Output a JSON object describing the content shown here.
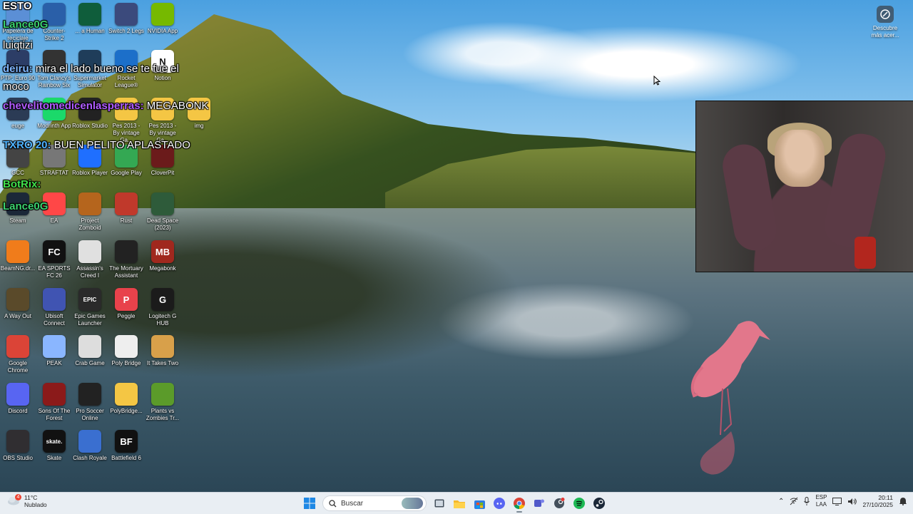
{
  "desktop_icons": [
    {
      "id": "papelera",
      "label": "Papelera de reciclaje",
      "icon": "recycle-bin-icon",
      "color": "#5b8fd6"
    },
    {
      "id": "counter",
      "label": "Counter-Strike 2",
      "icon": "cs2-icon",
      "color": "#2a5fa8"
    },
    {
      "id": "human",
      "label": "... a Human",
      "icon": "game-icon",
      "color": "#0f5d3b"
    },
    {
      "id": "switchlegs",
      "label": "Switch 2 Legs",
      "icon": "game-icon",
      "color": "#3b4a7c"
    },
    {
      "id": "nvidia",
      "label": "NVIDIA App",
      "icon": "nvidia-icon",
      "color": "#76b900"
    },
    {
      "id": "ptp",
      "label": "PTP: Euro 90",
      "icon": "game-icon",
      "color": "#2c3d66"
    },
    {
      "id": "rainbow",
      "label": "Tom Clancy's Rainbow Six",
      "icon": "r6-icon",
      "color": "#333"
    },
    {
      "id": "supermarket",
      "label": "Supermarket Simulator",
      "icon": "game-icon",
      "color": "#1f3d5a"
    },
    {
      "id": "rocket",
      "label": "Rocket League®",
      "icon": "rocket-league-icon",
      "color": "#1c6fc9"
    },
    {
      "id": "notion",
      "label": "Notion",
      "icon": "notion-icon",
      "color": "#ffffff",
      "text": "N"
    },
    {
      "id": "euge",
      "label": "euge",
      "icon": "image-icon",
      "color": "#2b3b55"
    },
    {
      "id": "modrinth",
      "label": "Modrinth App",
      "icon": "modrinth-icon",
      "color": "#1bd96a"
    },
    {
      "id": "roblox",
      "label": "Roblox Studio",
      "icon": "roblox-studio-icon",
      "color": "#222"
    },
    {
      "id": "pes1",
      "label": "Pes 2013 - By vintage Ga...",
      "icon": "folder-icon",
      "color": "#f4c644"
    },
    {
      "id": "pes2",
      "label": "Pes 2013 - By vintage Ga...",
      "icon": "folder-icon",
      "color": "#f4c644"
    },
    {
      "id": "img",
      "label": "img",
      "icon": "folder-icon",
      "color": "#f4c644"
    },
    {
      "id": "gcc",
      "label": "GCC",
      "icon": "game-icon",
      "color": "#444"
    },
    {
      "id": "strafat",
      "label": "STRAFTAT",
      "icon": "game-icon",
      "color": "#777"
    },
    {
      "id": "robloxplayer",
      "label": "Roblox Player",
      "icon": "roblox-icon",
      "color": "#1f6fff"
    },
    {
      "id": "googleplay",
      "label": "Google Play",
      "icon": "google-play-icon",
      "color": "#34a853"
    },
    {
      "id": "cloverpit",
      "label": "CloverPit",
      "icon": "game-icon",
      "color": "#6b1b1b"
    },
    {
      "id": "steam",
      "label": "Steam",
      "icon": "steam-icon",
      "color": "#1b2838"
    },
    {
      "id": "ea",
      "label": "EA",
      "icon": "ea-icon",
      "color": "#ff4747"
    },
    {
      "id": "zomboid",
      "label": "Project Zomboid",
      "icon": "zomboid-icon",
      "color": "#b5651d"
    },
    {
      "id": "rust",
      "label": "Rust",
      "icon": "rust-icon",
      "color": "#c0392b"
    },
    {
      "id": "deadspace",
      "label": "Dead Space (2023)",
      "icon": "dead-space-icon",
      "color": "#2e5b3a"
    },
    {
      "id": "beamng",
      "label": "BeamNG.dr...",
      "icon": "beamng-icon",
      "color": "#f07c1b"
    },
    {
      "id": "fc26",
      "label": "EA SPORTS FC 26",
      "icon": "fc26-icon",
      "color": "#111",
      "text": "FC"
    },
    {
      "id": "assassin",
      "label": "Assassin's Creed I",
      "icon": "assassins-creed-icon",
      "color": "#e0e0e0"
    },
    {
      "id": "mortuary",
      "label": "The Mortuary Assistant",
      "icon": "game-icon",
      "color": "#222"
    },
    {
      "id": "megabonk",
      "label": "Megabonk",
      "icon": "megabonk-icon",
      "color": "#a0281e",
      "text": "MB"
    },
    {
      "id": "awayout",
      "label": "A Way Out",
      "icon": "a-way-out-icon",
      "color": "#5a4a2a"
    },
    {
      "id": "ubisoft",
      "label": "Ubisoft Connect",
      "icon": "ubisoft-icon",
      "color": "#4054b2"
    },
    {
      "id": "epic",
      "label": "Epic Games Launcher",
      "icon": "epic-games-icon",
      "color": "#2a2a2a",
      "text": "EPIC"
    },
    {
      "id": "peggle",
      "label": "Peggle",
      "icon": "peggle-icon",
      "color": "#e8424b",
      "text": "P"
    },
    {
      "id": "logitech",
      "label": "Logitech G HUB",
      "icon": "logitech-icon",
      "color": "#1b1b1b",
      "text": "G"
    },
    {
      "id": "chrome",
      "label": "Google Chrome",
      "icon": "chrome-icon",
      "color": "#db4437"
    },
    {
      "id": "peak",
      "label": "PEAK",
      "icon": "peak-icon",
      "color": "#8ab6ff"
    },
    {
      "id": "crabgame",
      "label": "Crab Game",
      "icon": "crab-game-icon",
      "color": "#ddd"
    },
    {
      "id": "polybridge",
      "label": "Poly Bridge",
      "icon": "poly-bridge-icon",
      "color": "#eee"
    },
    {
      "id": "ittakestwo",
      "label": "It Takes Two",
      "icon": "it-takes-two-icon",
      "color": "#d8a04a"
    },
    {
      "id": "discord",
      "label": "Discord",
      "icon": "discord-icon",
      "color": "#5865f2"
    },
    {
      "id": "sonsforest",
      "label": "Sons Of The Forest",
      "icon": "sons-of-the-forest-icon",
      "color": "#8b1a1a"
    },
    {
      "id": "prosoccer",
      "label": "Pro Soccer Online",
      "icon": "soccer-icon",
      "color": "#222"
    },
    {
      "id": "polybridgefolder",
      "label": "PolyBridge...",
      "icon": "folder-icon",
      "color": "#f4c644"
    },
    {
      "id": "pvz",
      "label": "Plants vs Zombies Tr...",
      "icon": "pvz-icon",
      "color": "#5b9b2a"
    },
    {
      "id": "obs",
      "label": "OBS Studio",
      "icon": "obs-icon",
      "color": "#302e31"
    },
    {
      "id": "skate",
      "label": "Skate",
      "icon": "skate-icon",
      "color": "#111",
      "text": "skate."
    },
    {
      "id": "clashroyale",
      "label": "Clash Royale",
      "icon": "clash-royale-icon",
      "color": "#3a6fd0"
    },
    {
      "id": "bf6",
      "label": "Battlefield 6",
      "icon": "battlefield-icon",
      "color": "#111",
      "text": "BF"
    }
  ],
  "chat": [
    {
      "user": "ESTO",
      "text": "",
      "color": "#ffffff"
    },
    {
      "user": "Lance0G",
      "text": "",
      "color": "#3bd16f"
    },
    {
      "user": "",
      "text": "luiqtizi",
      "color": "#ffffff"
    },
    {
      "user": "deiru:",
      "text": " mira el lado bueno se te fue el",
      "color": "#7fb6ff"
    },
    {
      "user": "",
      "text": "moco",
      "color": "#ffffff"
    },
    {
      "user": "chevelitomedicenlasperras:",
      "text": " MEGABONK",
      "color": "#b05cff"
    },
    {
      "user": "TXRO 20:",
      "text": " BUEN PELITO APLASTADO",
      "color": "#4fb3ff"
    },
    {
      "user": "BotRix:",
      "text": "",
      "color": "#41e04a"
    },
    {
      "user": "Lance0G",
      "text": "",
      "color": "#3bd16f"
    }
  ],
  "discover": {
    "label": "Descubre más acer...",
    "icon": "discover-icon"
  },
  "taskbar": {
    "weather": {
      "temp": "11°C",
      "desc": "Nublado",
      "badge": "4"
    },
    "search_placeholder": "Buscar",
    "apps": [
      "start-icon",
      "search",
      "task-view-icon",
      "file-explorer-icon",
      "microsoft-store-icon",
      "discord-icon",
      "chrome-icon",
      "teams-icon",
      "steam-overlay-icon",
      "spotify-icon",
      "steam-icon"
    ],
    "language": {
      "lang": "ESP",
      "layout": "LAA"
    },
    "time": "20:11",
    "date": "27/10/2025"
  }
}
